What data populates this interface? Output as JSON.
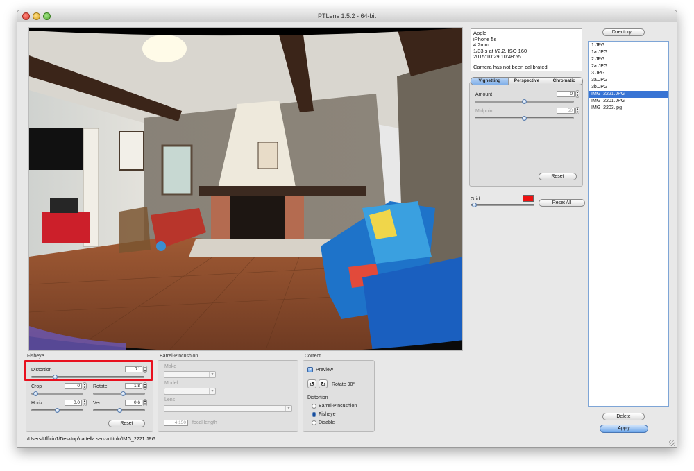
{
  "window": {
    "title": "PTLens 1.5.2 - 64-bit"
  },
  "exif": {
    "make": "Apple",
    "model": "iPhone 5s",
    "focal": "4.2mm",
    "exposure": "1/33 s at f/2.2, ISO 160",
    "datetime": "2015:10:29 10:48:55",
    "calib": "Camera has not been calibrated"
  },
  "tabs": [
    "Vignetting",
    "Perspective",
    "Chromatic Aberration"
  ],
  "vignetting": {
    "amount_label": "Amount",
    "amount_value": "0",
    "amount_level": 0.5,
    "midpoint_label": "Midpoint",
    "midpoint_value": "50",
    "midpoint_level": 0.5,
    "reset_label": "Reset"
  },
  "grid": {
    "label": "Grid",
    "level": 0.02,
    "color": "#ee1111",
    "reset_all_label": "Reset All"
  },
  "directory_label": "Directory...",
  "files": [
    "1.JPG",
    "1a.JPG",
    "2.JPG",
    "2a.JPG",
    "3.JPG",
    "3a.JPG",
    "3b.JPG",
    "IMG_2221.JPG",
    "IMG_2201.JPG",
    "IMG_2203.jpg"
  ],
  "selected_file_index": 7,
  "delete_label": "Delete",
  "apply_label": "Apply",
  "fisheye": {
    "title": "Fisheye",
    "distortion_label": "Distortion",
    "distortion_value": "71",
    "distortion_level": 0.2,
    "crop_label": "Crop",
    "crop_value": "0",
    "crop_level": 0.05,
    "rotate_label": "Rotate",
    "rotate_value": "1.8",
    "rotate_level": 0.6,
    "horiz_label": "Horiz.",
    "horiz_value": "0.0",
    "horiz_level": 0.5,
    "vert_label": "Vert.",
    "vert_value": "0.6",
    "vert_level": 0.52,
    "reset_label": "Reset"
  },
  "barrel": {
    "title": "Barrel-Pincushion",
    "make_label": "Make",
    "model_label": "Model",
    "lens_label": "Lens",
    "focal_value": "4.150",
    "focal_label": "focal length"
  },
  "correct": {
    "title": "Correct",
    "preview_label": "Preview",
    "rotate_label": "Rotate 90°",
    "rotate_ccw_icon": "↺",
    "rotate_cw_icon": "↻",
    "distortion_title": "Distortion",
    "options": [
      "Barrel-Pincushion",
      "Fisheye",
      "Disable"
    ],
    "selected_option": 1
  },
  "status_path": "/Users/Ufficio1/Desktop/cartella senza titolo/IMG_2221.JPG"
}
